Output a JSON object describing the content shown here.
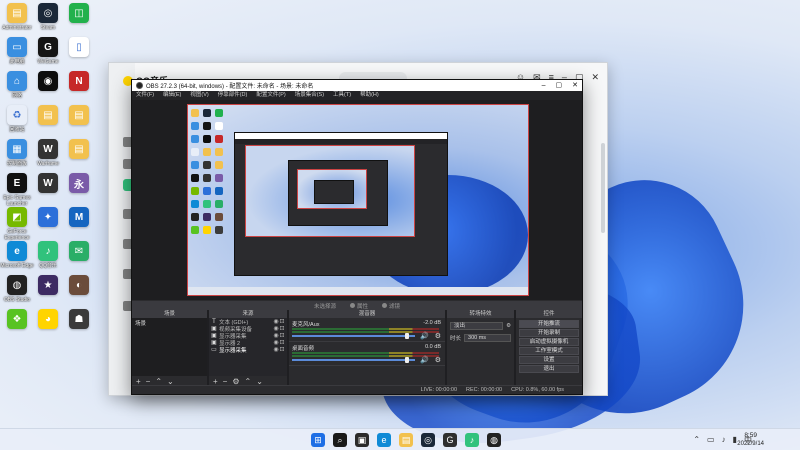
{
  "desktop": {
    "icons": [
      {
        "label": "Administrator",
        "color": "#f2c14e",
        "glyph": "▤"
      },
      {
        "label": "Steam",
        "color": "#1b2838",
        "glyph": "◎"
      },
      {
        "label": "",
        "color": "#22b14c",
        "glyph": "◫"
      },
      {
        "label": "此电脑",
        "color": "#3a8fe0",
        "glyph": "▭"
      },
      {
        "label": "WeGame",
        "color": "#151515",
        "glyph": "G"
      },
      {
        "label": "",
        "color": "#ffffff",
        "glyph": "▯"
      },
      {
        "label": "网络",
        "color": "#3a8fe0",
        "glyph": "⌂"
      },
      {
        "label": "",
        "color": "#0d0d0d",
        "glyph": "◉"
      },
      {
        "label": "",
        "color": "#c62828",
        "glyph": "N"
      },
      {
        "label": "回收站",
        "color": "#e8eef8",
        "glyph": "♻"
      },
      {
        "label": "",
        "color": "#f2c14e",
        "glyph": "▤"
      },
      {
        "label": "",
        "color": "#f2c14e",
        "glyph": "▤"
      },
      {
        "label": "控制面板",
        "color": "#3a8fe0",
        "glyph": "▦"
      },
      {
        "label": "Warframe",
        "color": "#333333",
        "glyph": "W"
      },
      {
        "label": "",
        "color": "#f2c14e",
        "glyph": "▤"
      },
      {
        "label": "Epic Games Launcher",
        "color": "#111111",
        "glyph": "E"
      },
      {
        "label": "",
        "color": "#333333",
        "glyph": "W"
      },
      {
        "label": "",
        "color": "#7a5ba8",
        "glyph": "永"
      },
      {
        "label": "GeForce Experience",
        "color": "#76b900",
        "glyph": "◩"
      },
      {
        "label": "",
        "color": "#2c6fd9",
        "glyph": "✦"
      },
      {
        "label": "",
        "color": "#1565c0",
        "glyph": "M"
      },
      {
        "label": "Microsoft Edge",
        "color": "#0f8ad6",
        "glyph": "e"
      },
      {
        "label": "QQ音乐",
        "color": "#31c27c",
        "glyph": "♪"
      },
      {
        "label": "",
        "color": "#2aae67",
        "glyph": "✉"
      },
      {
        "label": "OBS Studio",
        "color": "#222222",
        "glyph": "◍"
      },
      {
        "label": "",
        "color": "#3d2b63",
        "glyph": "★"
      },
      {
        "label": "",
        "color": "#6b4c3b",
        "glyph": "◐"
      },
      {
        "label": "",
        "color": "#58c322",
        "glyph": "❖"
      },
      {
        "label": "",
        "color": "#ffd400",
        "glyph": "◕"
      },
      {
        "label": "",
        "color": "#3b3b3b",
        "glyph": "☗"
      }
    ]
  },
  "qq": {
    "title": "QQ音乐"
  },
  "obs": {
    "title": "OBS 27.2.3 (64-bit, windows) - 配置文件: 未命名 - 场景: 未命名",
    "menu": [
      "文件(F)",
      "编辑(E)",
      "视图(V)",
      "停靠部件(D)",
      "配置文件(P)",
      "场景集合(S)",
      "工具(T)",
      "帮助(H)"
    ],
    "dockbar": {
      "scene_label": "未选择源",
      "props_label": "属性",
      "filters_label": "滤镜"
    },
    "scenes": {
      "header": "场景",
      "items": [
        "场景"
      ]
    },
    "sources": {
      "header": "来源",
      "items": [
        {
          "icon": "T",
          "name": "文本 (GDI+)"
        },
        {
          "icon": "▣",
          "name": "视频采集设备"
        },
        {
          "icon": "▣",
          "name": "显示器采集"
        },
        {
          "icon": "▣",
          "name": "显示器 2"
        },
        {
          "icon": "▭",
          "name": "显示器采集",
          "active": true
        }
      ]
    },
    "mixer": {
      "header": "混音器",
      "tracks": [
        {
          "name": "麦克风/Aux",
          "db": "-2.0 dB"
        },
        {
          "name": "桌面音频",
          "db": "0.0 dB"
        }
      ]
    },
    "transitions": {
      "header": "转场特效",
      "type": "淡出",
      "duration_label": "时长",
      "duration": "300 ms"
    },
    "controls": {
      "header": "控件",
      "buttons": [
        "开始推流",
        "开始录制",
        "启动虚拟摄像机",
        "工作室模式",
        "设置",
        "退出"
      ]
    },
    "status": {
      "live": "LIVE: 00:00:00",
      "rec": "REC: 00:00:00",
      "cpu": "CPU: 0.8%, 60.00 fps"
    }
  },
  "taskbar": {
    "apps": [
      {
        "name": "start",
        "color": "#1f6fe5",
        "glyph": "⊞"
      },
      {
        "name": "search",
        "color": "#1a1a1a",
        "glyph": "⌕"
      },
      {
        "name": "taskview",
        "color": "#2b2b2b",
        "glyph": "▣"
      },
      {
        "name": "edge",
        "color": "#0f8ad6",
        "glyph": "e"
      },
      {
        "name": "explorer",
        "color": "#f2c14e",
        "glyph": "▤"
      },
      {
        "name": "steam",
        "color": "#1b2838",
        "glyph": "◎"
      },
      {
        "name": "wegame",
        "color": "#2f2f2f",
        "glyph": "G"
      },
      {
        "name": "qqmusic",
        "color": "#31c27c",
        "glyph": "♪"
      },
      {
        "name": "obs",
        "color": "#222222",
        "glyph": "◍"
      }
    ],
    "time": "8:59",
    "date": "2022/9/14"
  }
}
